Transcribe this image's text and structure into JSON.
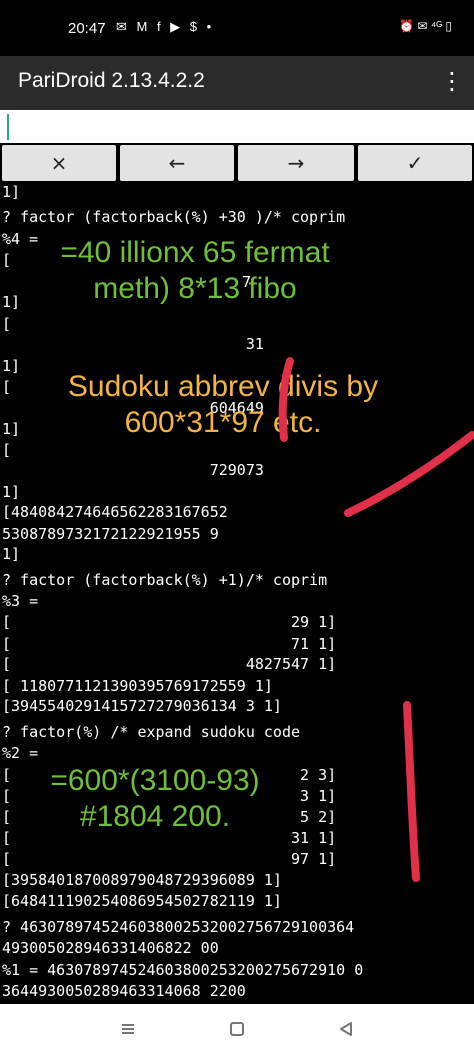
{
  "status_bar": {
    "time": "20:47",
    "notification_icons": "✉ M f ▶ $ •",
    "system_icons": "⏰ ✉ ⁴ᴳ ▯"
  },
  "app_bar": {
    "title": "PariDroid 2.13.4.2.2",
    "menu_icon": "more-vert-icon"
  },
  "input_field": {
    "value": ""
  },
  "keys": [
    {
      "name": "cancel",
      "label": "×"
    },
    {
      "name": "left",
      "label": "←"
    },
    {
      "name": "right",
      "label": "→"
    },
    {
      "name": "enter",
      "label": "✓"
    }
  ],
  "console_lines": [
    "1]",
    "? factor (factorback(%) +30 )/* coprim",
    "%4 =",
    "[",
    "",
    "1]",
    "[",
    "                           31",
    "1]",
    "[",
    "                       604649",
    "1]",
    "[",
    "                       729073",
    "1]",
    "[484084274646562283167652",
    "5308789732172122921955 9",
    "1]",
    "? factor (factorback(%) +1)/* coprim",
    "%3 =",
    "[                               29 1]",
    "[                               71 1]",
    "[                          4827547 1]",
    "[ 1180771121390395769172559 1]",
    "[3945540291415727279036134 3 1]",
    "? factor(%) /* expand sudoku code",
    "%2 =",
    "[                                2 3]",
    "[                                3 1]",
    "[                                5 2]",
    "[                               31 1]",
    "[                               97 1]",
    "[395840187008979048729396089 1]",
    "[648411190254086954502782119 1]",
    "? 4630789745246038002532002756729100364",
    "493005028946331406822 00",
    "%1 = 463078974524603800253200275672910 0",
    "3644930050289463314068 2200"
  ],
  "floating_digit": "7",
  "annotations": [
    {
      "lines": [
        "=40 illionx 65 fermat",
        "meth) 8*13 fibo"
      ],
      "color": "#6fbf3a"
    },
    {
      "lines": [
        "Sudoku abbrev divis by",
        "600*31*97 etc."
      ],
      "color": "#f2b544"
    },
    {
      "lines": [
        "=600*(3100-93)",
        "#1804 200."
      ],
      "color": "#6fbf3a"
    }
  ],
  "ink_color": "#e0304a",
  "nav_bar": {
    "recent_icon": "recent-apps-icon",
    "home_icon": "home-icon",
    "back_icon": "back-icon"
  }
}
